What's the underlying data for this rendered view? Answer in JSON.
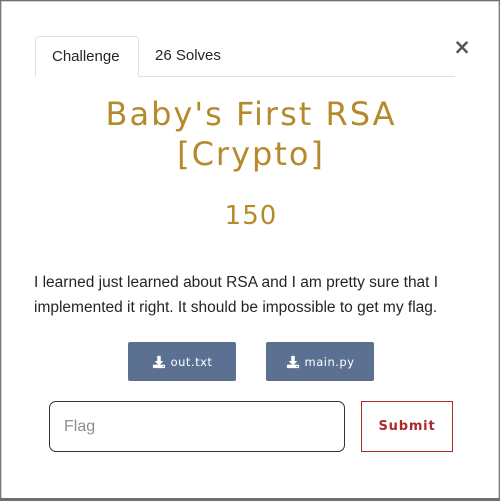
{
  "modal": {
    "close_label": "×",
    "tabs": [
      {
        "label": "Challenge"
      },
      {
        "label": "26 Solves"
      }
    ],
    "challenge": {
      "title_line1": "Baby's First RSA",
      "title_line2": "[Crypto]",
      "value": "150",
      "description_line1": "I learned just learned about RSA and I am pretty sure that I",
      "description_line2": "implemented it right. It should be impossible to get my flag.",
      "files": [
        {
          "label": "out.txt",
          "icon": "download-icon"
        },
        {
          "label": "main.py",
          "icon": "download-icon"
        }
      ]
    },
    "flag_input": {
      "placeholder": "Flag",
      "value": ""
    },
    "submit_label": "Submit",
    "colors": {
      "accent_gold": "#b58a2c",
      "file_button_bg": "#5c7091",
      "submit_red": "#b02a2a"
    }
  }
}
